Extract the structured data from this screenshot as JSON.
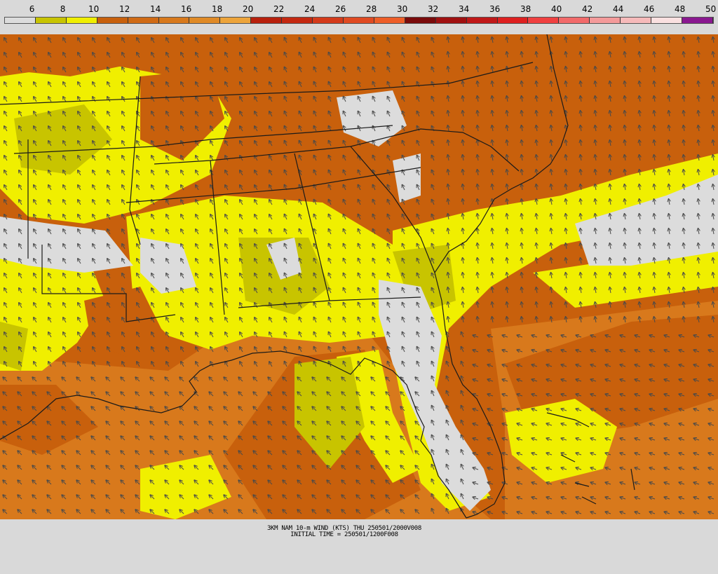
{
  "legend": {
    "labels": [
      "6",
      "8",
      "10",
      "12",
      "14",
      "16",
      "18",
      "20",
      "22",
      "24",
      "26",
      "28",
      "30",
      "32",
      "34",
      "36",
      "38",
      "40",
      "42",
      "44",
      "46",
      "48",
      "50"
    ],
    "colors": [
      "#dcdcdc",
      "#c8c400",
      "#f0ef00",
      "#c8600c",
      "#d06a14",
      "#d8791c",
      "#e08a26",
      "#eda43a",
      "#b8200c",
      "#c42810",
      "#d43a1a",
      "#e04a22",
      "#ee5e28",
      "#7a0a0a",
      "#a01010",
      "#c01818",
      "#de2020",
      "#f04040",
      "#f26a6a",
      "#f49a9a",
      "#f6baba",
      "#fae0e0",
      "#8a1890"
    ]
  },
  "caption": {
    "line1": "3KM NAM 10-m WIND (KTS) THU 250501/2000V008",
    "line2": "INITIAL TIME = 250501/1200F008"
  },
  "map": {
    "map_colors": {
      "ocean_gulf": "#d8791c",
      "land_base": "#c8600c",
      "calm_gray": "#dcdcdc",
      "yellow": "#f0ef00",
      "olive": "#c8c400",
      "border": "#1a1a1a",
      "arrow": "#4a4a4a"
    }
  }
}
